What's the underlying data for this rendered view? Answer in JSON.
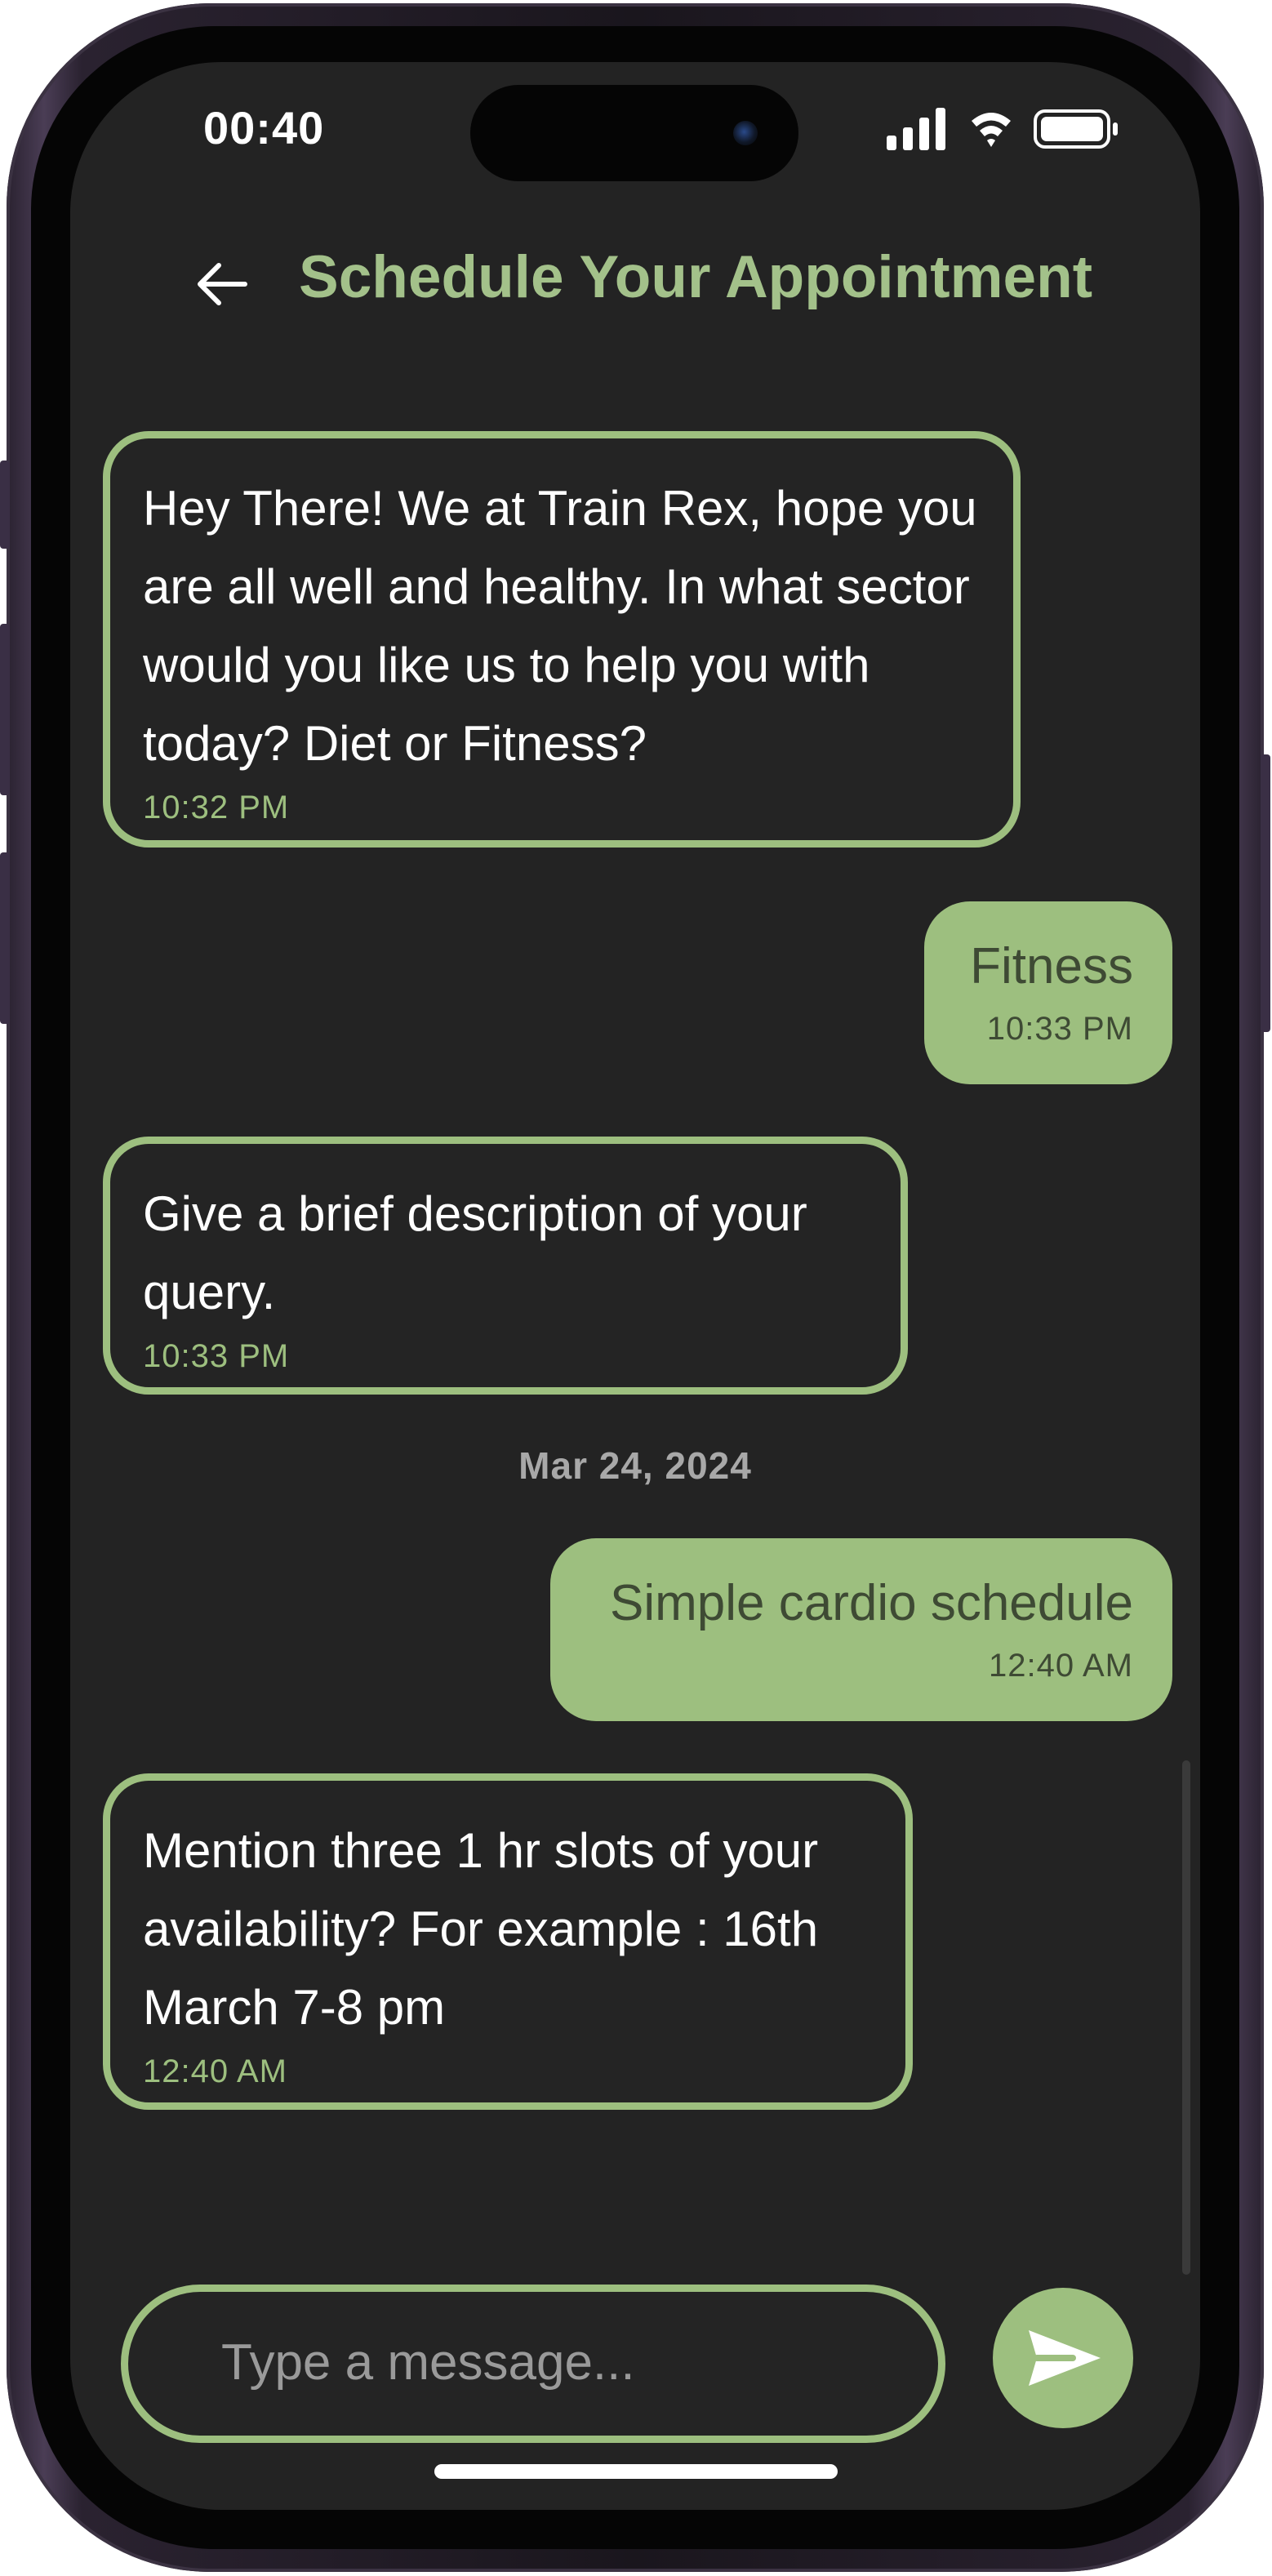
{
  "status_bar": {
    "time": "00:40"
  },
  "header": {
    "title": "Schedule Your Appointment"
  },
  "messages": [
    {
      "sender": "bot",
      "text": "Hey There! We at Train Rex, hope you are all well and healthy. In what sector would you like us to help you with today? Diet or Fitness?",
      "time": "10:32 PM"
    },
    {
      "sender": "user",
      "text": "Fitness",
      "time": "10:33 PM"
    },
    {
      "sender": "bot",
      "text": "Give a brief description of your query.",
      "time": "10:33 PM"
    },
    {
      "sender": "user",
      "text": "Simple cardio schedule",
      "time": "12:40 AM"
    },
    {
      "sender": "bot",
      "text": "Mention three 1 hr slots of your availability? For example : 16th March 7-8 pm",
      "time": "12:40 AM"
    }
  ],
  "date_separator": "Mar 24, 2024",
  "composer": {
    "placeholder": "Type a message...",
    "value": ""
  },
  "colors": {
    "accent": "#9dbf7f",
    "title": "#a3c18a",
    "background": "#232323",
    "user_text": "#3e4a34"
  },
  "icons": {
    "back": "arrow-left-icon",
    "send": "send-icon"
  }
}
